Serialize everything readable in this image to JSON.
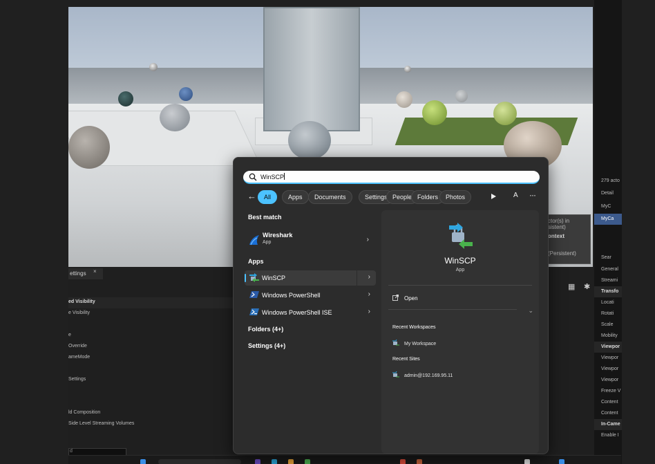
{
  "editor": {
    "settings_tab": "ettings",
    "settings_close": "×",
    "settings_rows": [
      {
        "label": "ed Visibility",
        "bold": true
      },
      {
        "label": "e Visibility",
        "bold": false
      },
      {
        "label": "",
        "bold": false
      },
      {
        "label": "e",
        "bold": false
      },
      {
        "label": "Override",
        "bold": false
      },
      {
        "label": "ameMode",
        "bold": false
      },
      {
        "label": "",
        "bold": false
      },
      {
        "label": "Settings",
        "bold": false
      },
      {
        "label": "",
        "bold": false
      },
      {
        "label": "",
        "bold": false
      },
      {
        "label": "ld Composition",
        "bold": false
      },
      {
        "label": "Side Level Streaming Volumes",
        "bold": false
      }
    ],
    "context_fragment": {
      "line1": "ctor(s) in",
      "line2": "sistent)",
      "line3": "ontext",
      "line4": "(Persistent)"
    },
    "details_rows": [
      {
        "label": "279 acto",
        "type": "plain"
      },
      {
        "label": "Detail",
        "type": "plain"
      },
      {
        "label": "MyC",
        "type": "plain"
      },
      {
        "label": "MyCa",
        "type": "sel"
      },
      {
        "label": "Sear",
        "type": "plain"
      },
      {
        "label": "General",
        "type": "plain"
      },
      {
        "label": "Streami",
        "type": "plain"
      },
      {
        "label": "Transfo",
        "type": "hdr"
      },
      {
        "label": "Locati",
        "type": "plain"
      },
      {
        "label": "Rotati",
        "type": "plain"
      },
      {
        "label": "Scale",
        "type": "plain"
      },
      {
        "label": "Mobility",
        "type": "plain"
      },
      {
        "label": "Viewpor",
        "type": "hdr"
      },
      {
        "label": "Viewpor",
        "type": "plain"
      },
      {
        "label": "Viewpor",
        "type": "plain"
      },
      {
        "label": "Viewpor",
        "type": "plain"
      },
      {
        "label": "Freeze V",
        "type": "plain"
      },
      {
        "label": "Content",
        "type": "plain"
      },
      {
        "label": "Content",
        "type": "plain"
      },
      {
        "label": "In-Came",
        "type": "hdr"
      },
      {
        "label": "Enable I",
        "type": "plain"
      }
    ]
  },
  "search": {
    "query": "WinSCP",
    "filters": [
      "All",
      "Apps",
      "Documents",
      "Settings",
      "People",
      "Folders",
      "Photos"
    ],
    "active_filter": "All",
    "a_label": "A",
    "more_label": "···",
    "best_match": {
      "heading": "Best match",
      "title": "Wireshark",
      "subtitle": "App",
      "icon": "wireshark-icon"
    },
    "apps": {
      "heading": "Apps",
      "items": [
        {
          "label": "WinSCP",
          "icon": "winscp-icon",
          "selected": true
        },
        {
          "label": "Windows PowerShell",
          "icon": "powershell-icon",
          "selected": false
        },
        {
          "label": "Windows PowerShell ISE",
          "icon": "powershell-ise-icon",
          "selected": false
        }
      ]
    },
    "folders_label": "Folders (4+)",
    "settings_label": "Settings (4+)",
    "preview": {
      "name": "WinSCP",
      "type": "App",
      "open_label": "Open",
      "recent_workspaces_heading": "Recent Workspaces",
      "workspace": "My Workspace",
      "recent_sites_heading": "Recent Sites",
      "site": "admin@192.169.95.11"
    },
    "accent_color": "#4cc2ff"
  }
}
